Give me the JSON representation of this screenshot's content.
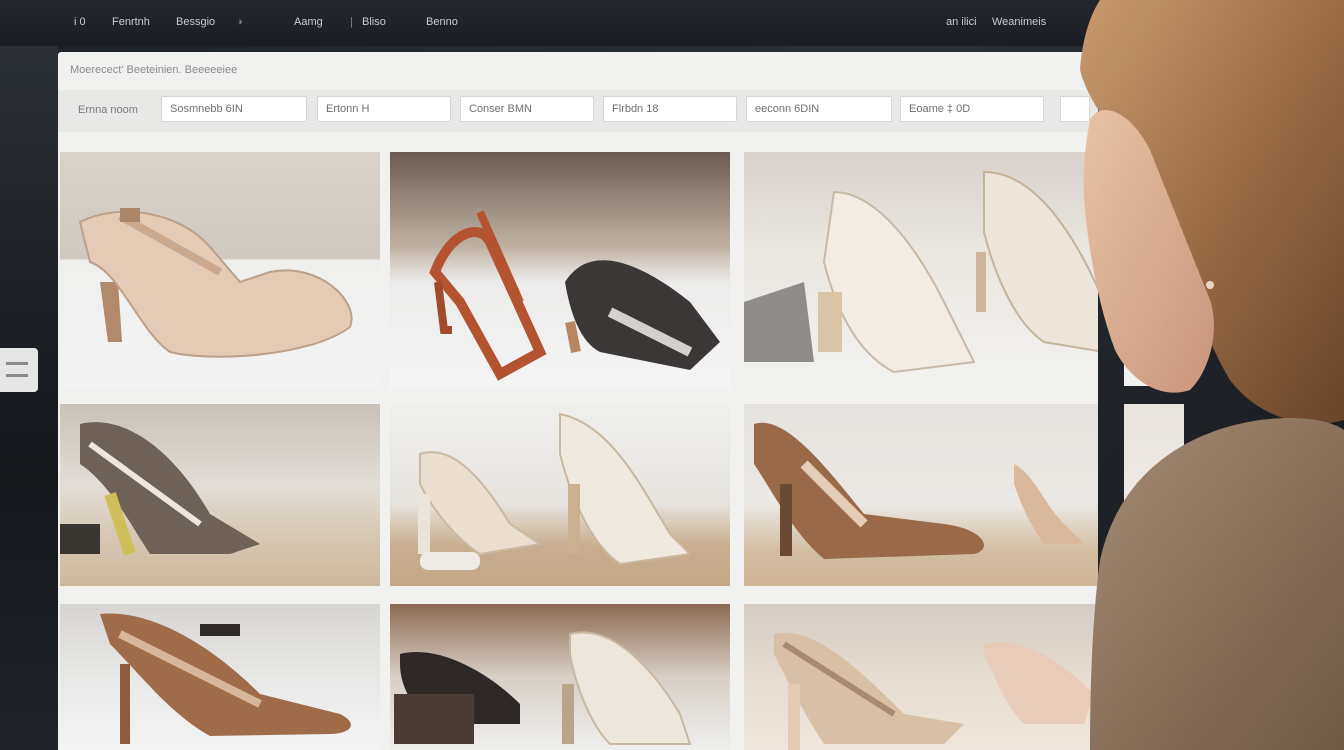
{
  "nav": {
    "items": [
      "i 0",
      "Fenrtnh",
      "Bessgio",
      "Aamg",
      "Bliso",
      "Benno"
    ],
    "right_items": [
      "an ilici",
      "Weanimeis"
    ]
  },
  "window": {
    "breadcrumb": "Moerecect'  Beeteinien. Beeeeeiee",
    "filters": {
      "label": "Ernna noom",
      "fields": [
        "Sosmnebb 6IN",
        "Ertonn H",
        "Conser BMN",
        "Flrbdn 18",
        "eeconn 6DIN",
        "Eoame ‡ 0D"
      ]
    }
  },
  "colors": {
    "page_bg": "#1c2026",
    "window_bg": "#f1f1f0",
    "filter_bar": "#e8e8e7",
    "shoe_nude": "#d9b89c",
    "shoe_rust": "#b4532f",
    "shoe_bronze": "#9a6a48"
  },
  "grid": {
    "products": [
      {
        "name": "nude-slingback-heel"
      },
      {
        "name": "rust-strappy-heel-and-black-wedge"
      },
      {
        "name": "white-lace-sandals"
      },
      {
        "name": "metallic-dotted-heel"
      },
      {
        "name": "glitter-heel-pair"
      },
      {
        "name": "bronze-pointed-pump"
      },
      {
        "name": "brown-slingback-heel"
      },
      {
        "name": "black-and-silver-heels"
      },
      {
        "name": "glitter-pointed-pump"
      }
    ]
  }
}
